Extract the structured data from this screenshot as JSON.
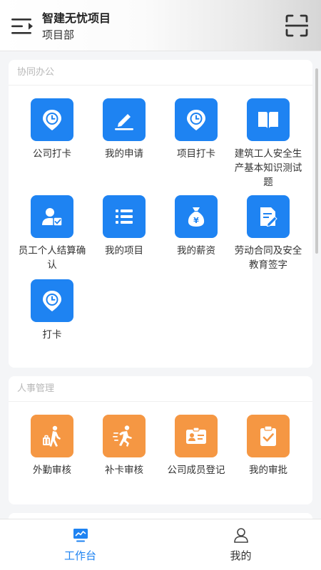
{
  "header": {
    "title": "智建无忧项目",
    "subtitle": "项目部"
  },
  "sections": [
    {
      "title": "协同办公",
      "items": [
        {
          "label": "公司打卡",
          "icon": "clock-pin-icon"
        },
        {
          "label": "我的申请",
          "icon": "pencil-icon"
        },
        {
          "label": "项目打卡",
          "icon": "clock-pin-icon"
        },
        {
          "label": "建筑工人安全生产基本知识测试题",
          "icon": "book-icon"
        },
        {
          "label": "员工个人结算确认",
          "icon": "person-check-icon"
        },
        {
          "label": "我的项目",
          "icon": "list-icon"
        },
        {
          "label": "我的薪资",
          "icon": "money-bag-icon"
        },
        {
          "label": "劳动合同及安全教育签字",
          "icon": "document-edit-icon"
        },
        {
          "label": "打卡",
          "icon": "clock-pin-icon"
        }
      ]
    },
    {
      "title": "人事管理",
      "items": [
        {
          "label": "外勤审核",
          "icon": "traveler-icon"
        },
        {
          "label": "补卡审核",
          "icon": "running-person-icon"
        },
        {
          "label": "公司成员登记",
          "icon": "id-card-icon"
        },
        {
          "label": "我的审批",
          "icon": "clipboard-check-icon"
        }
      ]
    }
  ],
  "tabbar": {
    "tabs": [
      {
        "label": "工作台",
        "icon": "monitor-icon",
        "active": true
      },
      {
        "label": "我的",
        "icon": "person-icon",
        "active": false
      }
    ]
  },
  "colors": {
    "primary_blue": "#1e83f2",
    "accent_orange": "#f59743",
    "active_tab": "#1e83f2",
    "inactive_tab": "#333333"
  }
}
